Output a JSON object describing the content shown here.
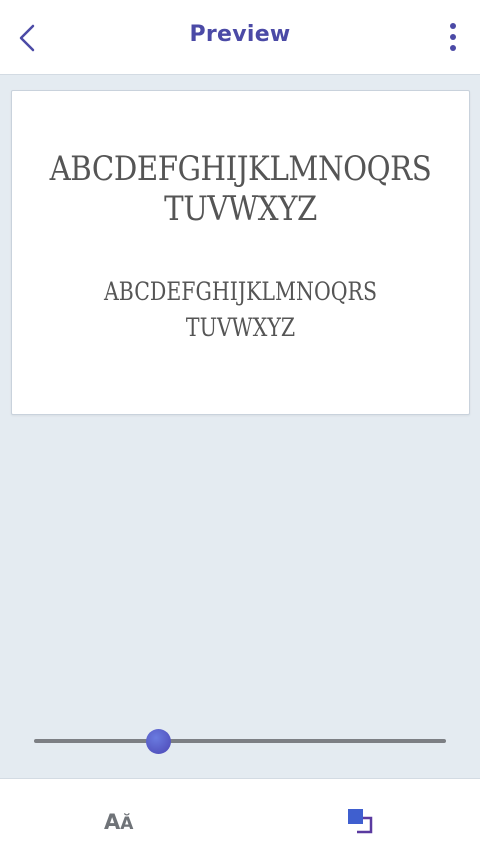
{
  "header": {
    "title": "Preview"
  },
  "preview": {
    "large_line1": "ABCDEFGHIJKLMNOQRS",
    "large_line2": "TUVWXYZ",
    "small_line1": "ABCDEFGHIJKLMNOQRS",
    "small_line2": "TUVWXYZ"
  },
  "slider": {
    "value": 0.3
  },
  "bottom_bar": {
    "font_size_big": "A",
    "font_size_small": "Ă"
  },
  "colors": {
    "accent": "#4b4aa6",
    "background": "#e4ebf1",
    "sample_text": "#555555"
  },
  "icons": {
    "back": "chevron-left-icon",
    "more": "more-vertical-icon",
    "layers": "layers-icon"
  }
}
